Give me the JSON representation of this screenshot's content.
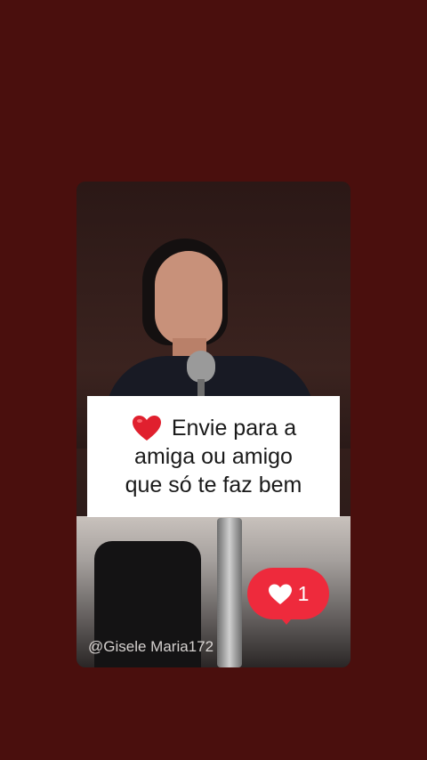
{
  "caption": {
    "line1": "Envie para a",
    "line2": "amiga ou amigo",
    "line3": "que só te faz bem",
    "emoji_icon": "heart-emoji-icon"
  },
  "like_badge": {
    "count": "1",
    "icon": "heart-icon",
    "color": "#ee2a3c"
  },
  "watermark": {
    "handle": "@Gisele Maria172"
  },
  "colors": {
    "background": "#4a0f0d",
    "caption_bg": "#ffffff"
  }
}
